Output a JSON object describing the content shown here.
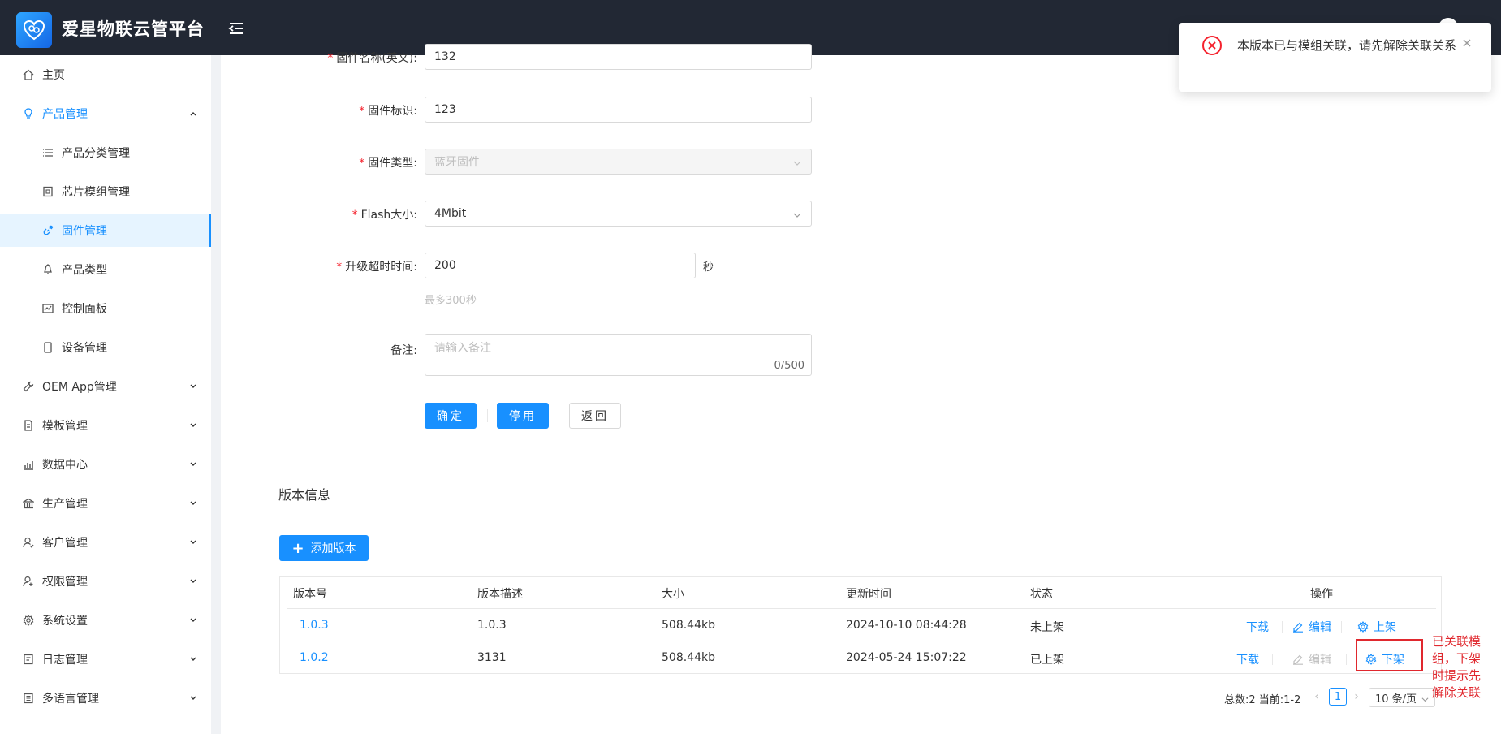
{
  "app": {
    "title": "爱星物联云管平台"
  },
  "sidebar": {
    "items": [
      {
        "label": "主页",
        "icon": "home-icon"
      },
      {
        "label": "产品管理",
        "icon": "lightbulb-icon",
        "expanded": true
      },
      {
        "label": "产品分类管理",
        "icon": "list-icon"
      },
      {
        "label": "芯片模组管理",
        "icon": "chip-icon"
      },
      {
        "label": "固件管理",
        "icon": "link-icon",
        "active": true
      },
      {
        "label": "产品类型",
        "icon": "bell-icon"
      },
      {
        "label": "控制面板",
        "icon": "chart-icon"
      },
      {
        "label": "设备管理",
        "icon": "device-icon"
      },
      {
        "label": "OEM App管理",
        "icon": "wrench-icon"
      },
      {
        "label": "模板管理",
        "icon": "template-icon"
      },
      {
        "label": "数据中心",
        "icon": "bar-chart-icon"
      },
      {
        "label": "生产管理",
        "icon": "bank-icon"
      },
      {
        "label": "客户管理",
        "icon": "customer-icon"
      },
      {
        "label": "权限管理",
        "icon": "permission-icon"
      },
      {
        "label": "系统设置",
        "icon": "gear-icon"
      },
      {
        "label": "日志管理",
        "icon": "log-icon"
      },
      {
        "label": "多语言管理",
        "icon": "language-icon"
      }
    ]
  },
  "form": {
    "name_en": {
      "label": "固件名称(英文)",
      "value": "132"
    },
    "identifier": {
      "label": "固件标识",
      "value": "123"
    },
    "type": {
      "label": "固件类型",
      "value": "蓝牙固件"
    },
    "flash": {
      "label": "Flash大小",
      "value": "4Mbit"
    },
    "timeout": {
      "label": "升级超时时间",
      "value": "200",
      "unit": "秒",
      "hint": "最多300秒"
    },
    "remark": {
      "label": "备注",
      "placeholder": "请输入备注",
      "counter": "0/500"
    },
    "colon": ":",
    "buttons": {
      "confirm": "确定",
      "disable": "停用",
      "back": "返回"
    }
  },
  "versions": {
    "title": "版本信息",
    "add_label": "添加版本",
    "columns": [
      "版本号",
      "版本描述",
      "大小",
      "更新时间",
      "状态",
      "操作"
    ],
    "rows": [
      {
        "version": "1.0.3",
        "desc": "1.0.3",
        "size": "508.44kb",
        "updated": "2024-10-10 08:44:28",
        "status": "未上架",
        "ops": {
          "download": "下载",
          "edit": "编辑",
          "publish": "上架"
        }
      },
      {
        "version": "1.0.2",
        "desc": "3131",
        "size": "508.44kb",
        "updated": "2024-05-24 15:07:22",
        "status": "已上架",
        "ops": {
          "download": "下载",
          "edit": "编辑",
          "unpublish": "下架"
        }
      }
    ],
    "pagination": {
      "total": "总数:2 当前:1-2",
      "page": "1",
      "page_size": "10 条/页",
      "prev": "‹",
      "next": "›"
    }
  },
  "annotation": "已关联模组，下架时提示先解除关联",
  "toast": {
    "message": "本版本已与模组关联，请先解除关联关系",
    "type": "error"
  },
  "colors": {
    "primary": "#1890ff",
    "error": "#f5222d",
    "annotation": "#e0282e",
    "header": "#222834"
  }
}
